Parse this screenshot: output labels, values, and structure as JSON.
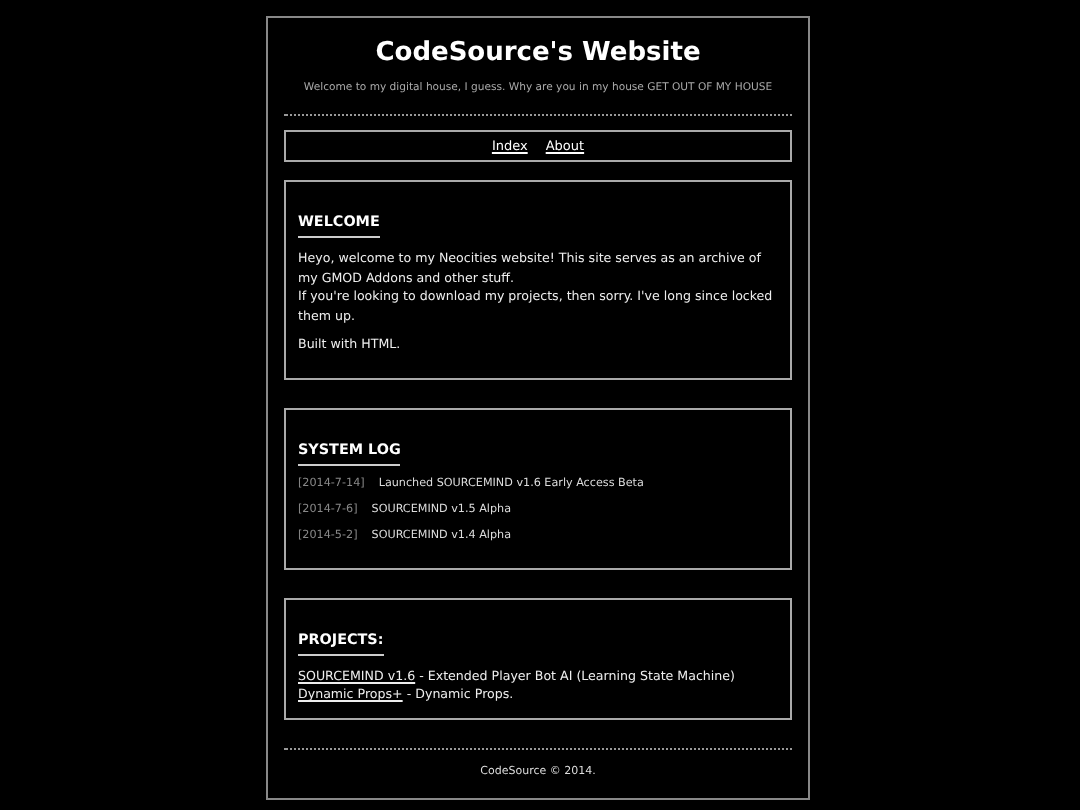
{
  "header": {
    "title": "CodeSource's Website",
    "subtitle": "Welcome to my digital house, I guess. Why are you in my house GET OUT OF MY HOUSE"
  },
  "nav": [
    {
      "label": "Index"
    },
    {
      "label": "About"
    }
  ],
  "welcome": {
    "heading": "WELCOME",
    "paragraphs": [
      "Heyo, welcome to my Neocities website! This site serves as an archive of my GMOD Addons and other stuff.\nIf you're looking to download my projects, then sorry. I've long since locked them up.",
      "Built with HTML."
    ]
  },
  "system_log": {
    "heading": "SYSTEM LOG",
    "entries": [
      {
        "date": "[2014-7-14]",
        "text": "Launched SOURCEMIND v1.6 Early Access Beta"
      },
      {
        "date": "[2014-7-6]",
        "text": "SOURCEMIND v1.5 Alpha"
      },
      {
        "date": "[2014-5-2]",
        "text": "SOURCEMIND v1.4 Alpha"
      }
    ]
  },
  "projects": {
    "heading": "PROJECTS:",
    "items": [
      {
        "link": "SOURCEMIND v1.6",
        "description": "- Extended Player Bot AI (Learning State Machine)"
      },
      {
        "link": "Dynamic Props+",
        "description": "- Dynamic Props."
      }
    ]
  },
  "footer": "CodeSource © 2014."
}
